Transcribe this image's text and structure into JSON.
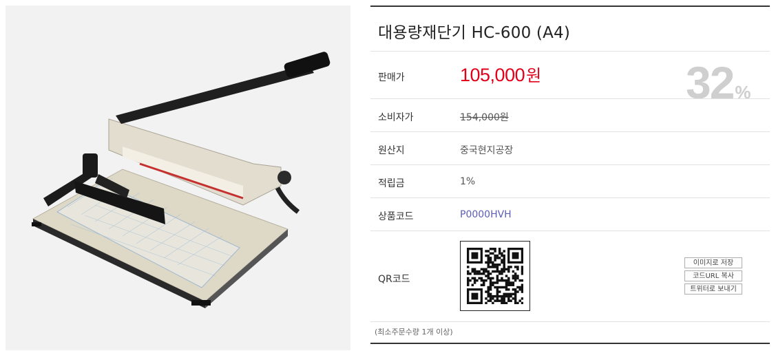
{
  "product": {
    "title": "대용량재단기 HC-600 (A4)",
    "image_alt": "paper-cutter-product-image"
  },
  "price": {
    "label": "판매가",
    "value": "105,000",
    "unit": "원",
    "discount": "32",
    "discount_unit": "%"
  },
  "details": [
    {
      "label": "소비자가",
      "value": "154,000원"
    },
    {
      "label": "원산지",
      "value": "중국현지공장"
    },
    {
      "label": "적립금",
      "value": "1%"
    },
    {
      "label": "상품코드",
      "value": "P0000HVH"
    }
  ],
  "qr": {
    "label": "QR코드",
    "buttons": [
      "이미지로 저장",
      "코드URL 복사",
      "트위터로 보내기"
    ]
  },
  "note": "(최소주문수량 1개 이상)",
  "colors": {
    "price": "#e2001a",
    "discount": "#cfcfcf",
    "code": "#5c5cb8",
    "divider": "#e2e2e2"
  }
}
